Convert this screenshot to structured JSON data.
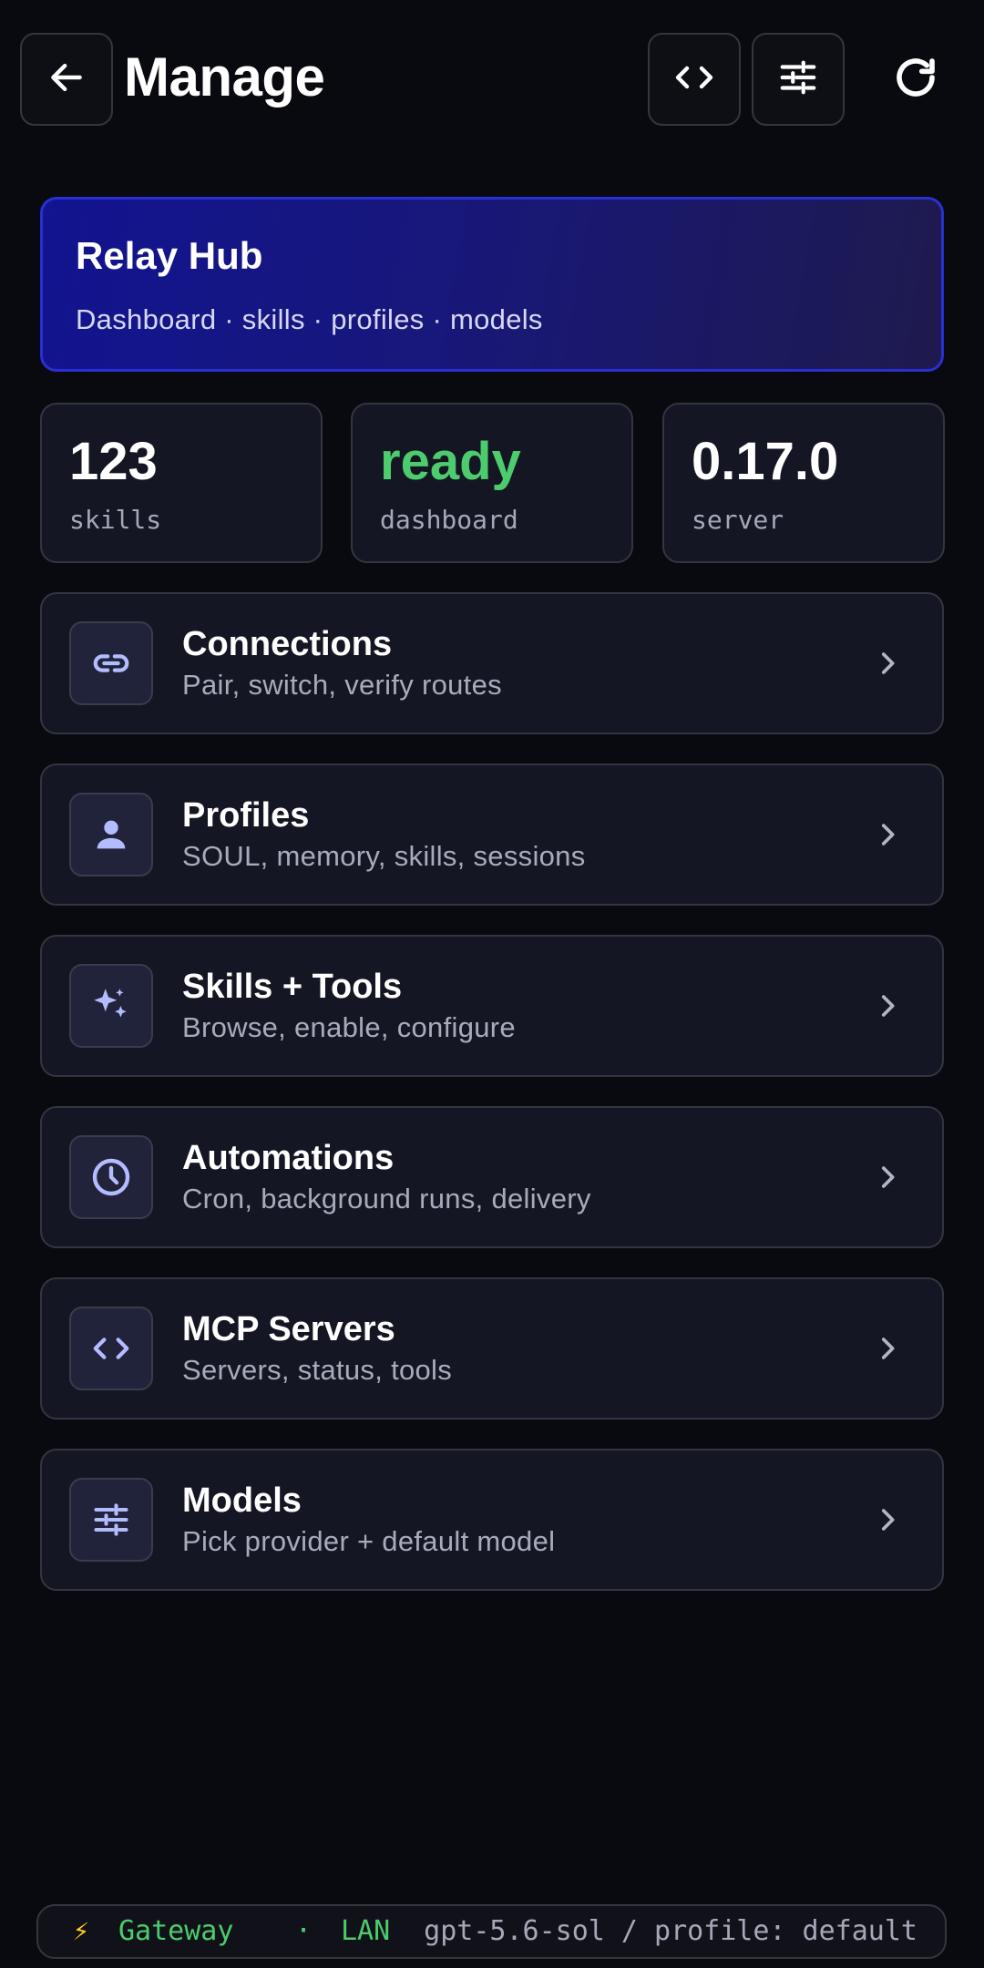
{
  "header": {
    "title": "Manage",
    "back_icon": "arrow-left-icon",
    "code_icon": "code-icon",
    "settings_icon": "sliders-icon",
    "refresh_icon": "refresh-icon"
  },
  "hero": {
    "title": "Relay Hub",
    "subtitle": "Dashboard · skills · profiles · models",
    "accent_color": "#2a2fd4"
  },
  "stats": [
    {
      "value": "123",
      "label": "skills"
    },
    {
      "value": "ready",
      "label": "dashboard",
      "color": "#4ccc6c"
    },
    {
      "value": "0.17.0",
      "label": "server"
    }
  ],
  "menu": [
    {
      "title": "Connections",
      "subtitle": "Pair, switch, verify routes",
      "icon": "link-icon"
    },
    {
      "title": "Profiles",
      "subtitle": "SOUL, memory, skills, sessions",
      "icon": "person-icon"
    },
    {
      "title": "Skills + Tools",
      "subtitle": "Browse, enable, configure",
      "icon": "sparkles-icon"
    },
    {
      "title": "Automations",
      "subtitle": "Cron, background runs, delivery",
      "icon": "clock-icon"
    },
    {
      "title": "MCP Servers",
      "subtitle": "Servers, status, tools",
      "icon": "code-icon"
    },
    {
      "title": "Models",
      "subtitle": "Pick provider + default model",
      "icon": "sliders-icon"
    }
  ],
  "footer": {
    "bolt": "⚡",
    "gateway": "Gateway",
    "separator": "·",
    "network": "LAN",
    "model_profile": "gpt-5.6-sol / profile: default",
    "status_color": "#4ccc6c"
  }
}
